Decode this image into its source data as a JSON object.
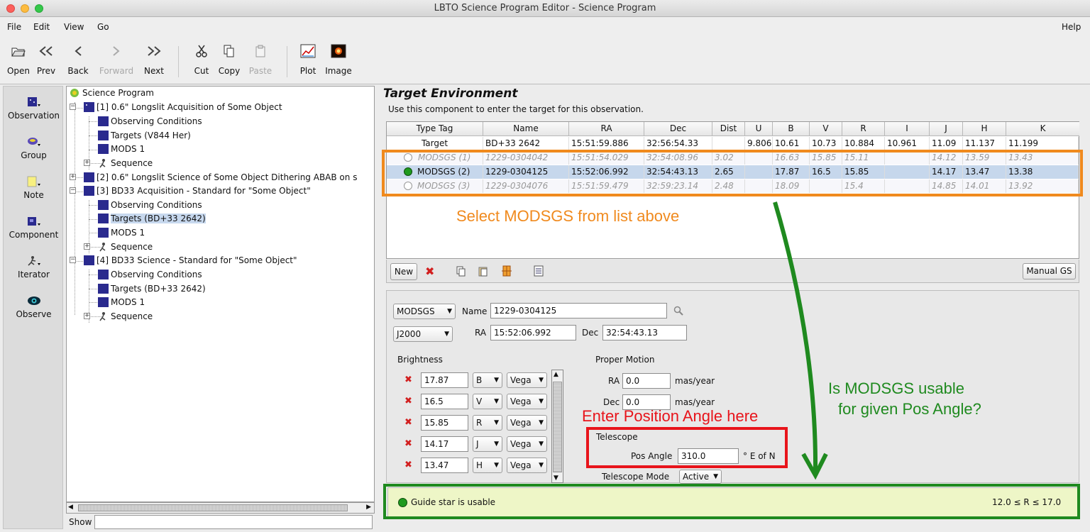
{
  "window": {
    "title": "LBTO Science Program Editor - Science Program"
  },
  "menu": {
    "file": "File",
    "edit": "Edit",
    "view": "View",
    "go": "Go",
    "help": "Help"
  },
  "toolbar": {
    "open": "Open",
    "prev": "Prev",
    "back": "Back",
    "forward": "Forward",
    "next": "Next",
    "cut": "Cut",
    "copy": "Copy",
    "paste": "Paste",
    "plot": "Plot",
    "image": "Image"
  },
  "palette": {
    "observation": "Observation",
    "group": "Group",
    "note": "Note",
    "component": "Component",
    "iterator": "Iterator",
    "observe": "Observe"
  },
  "tree": {
    "root": "Science Program",
    "obs1": "[1] 0.6\" Longslit Acquisition of Some Object",
    "obs1_cond": "Observing Conditions",
    "obs1_targets": "Targets (V844 Her)",
    "obs1_inst": "MODS 1",
    "obs1_seq": "Sequence",
    "obs2": "[2] 0.6\" Longslit Science of Some Object Dithering ABAB on s",
    "obs3": "[3] BD33 Acquisition - Standard for \"Some Object\"",
    "obs3_cond": "Observing Conditions",
    "obs3_targets": "Targets (BD+33 2642)",
    "obs3_inst": "MODS 1",
    "obs3_seq": "Sequence",
    "obs4": "[4] BD33 Science - Standard for \"Some Object\"",
    "obs4_cond": "Observing Conditions",
    "obs4_targets": "Targets (BD+33 2642)",
    "obs4_inst": "MODS 1",
    "obs4_seq": "Sequence"
  },
  "show_label": "Show",
  "env": {
    "title": "Target Environment",
    "description": "Use this component to enter the target for this observation."
  },
  "table": {
    "headers": [
      "Type Tag",
      "Name",
      "RA",
      "Dec",
      "Dist",
      "U",
      "B",
      "V",
      "R",
      "I",
      "J",
      "H",
      "K"
    ],
    "rows": [
      [
        "Target",
        "BD+33 2642",
        "15:51:59.886",
        "32:56:54.33",
        "",
        "9.806",
        "10.61",
        "10.73",
        "10.884",
        "10.961",
        "11.09",
        "11.137",
        "11.199"
      ],
      [
        "MODSGS (1)",
        "1229-0304042",
        "15:51:54.029",
        "32:54:08.96",
        "3.02",
        "",
        "16.63",
        "15.85",
        "15.11",
        "",
        "14.12",
        "13.59",
        "13.43"
      ],
      [
        "MODSGS (2)",
        "1229-0304125",
        "15:52:06.992",
        "32:54:43.13",
        "2.65",
        "",
        "17.87",
        "16.5",
        "15.85",
        "",
        "14.17",
        "13.47",
        "13.38"
      ],
      [
        "MODSGS (3)",
        "1229-0304076",
        "15:51:59.479",
        "32:59:23.14",
        "2.48",
        "",
        "18.09",
        "",
        "15.4",
        "",
        "14.85",
        "14.01",
        "13.92"
      ]
    ]
  },
  "tools": {
    "new": "New",
    "manual_gs": "Manual GS"
  },
  "detail": {
    "type": "MODSGS",
    "name_label": "Name",
    "name_value": "1229-0304125",
    "epoch": "J2000",
    "ra_label": "RA",
    "ra_value": "15:52:06.992",
    "dec_label": "Dec",
    "dec_value": "32:54:43.13",
    "brightness_label": "Brightness",
    "magnitudes": [
      {
        "value": "17.87",
        "band": "B",
        "system": "Vega"
      },
      {
        "value": "16.5",
        "band": "V",
        "system": "Vega"
      },
      {
        "value": "15.85",
        "band": "R",
        "system": "Vega"
      },
      {
        "value": "14.17",
        "band": "J",
        "system": "Vega"
      },
      {
        "value": "13.47",
        "band": "H",
        "system": "Vega"
      }
    ],
    "pm_label": "Proper Motion",
    "pm_ra_label": "RA",
    "pm_ra_value": "0.0",
    "pm_dec_label": "Dec",
    "pm_dec_value": "0.0",
    "pm_unit": "mas/year",
    "telescope_label": "Telescope",
    "pos_angle_label": "Pos Angle",
    "pos_angle_value": "310.0",
    "pos_angle_unit": "° E of N",
    "tel_mode_label": "Telescope Mode",
    "tel_mode_value": "Active"
  },
  "status": {
    "text": "Guide star is usable",
    "range": "12.0 ≤ R ≤ 17.0"
  },
  "annotations": {
    "select": "Select MODSGS from list above",
    "posangle": "Enter Position Angle here",
    "usable1": "Is MODSGS usable",
    "usable2": "for given Pos Angle?"
  },
  "colors": {
    "orange": "#f08a1e",
    "red": "#e8141b",
    "green": "#1f8a1f",
    "status_bg": "#eef6c7",
    "selected_row": "#c6d7ec"
  }
}
